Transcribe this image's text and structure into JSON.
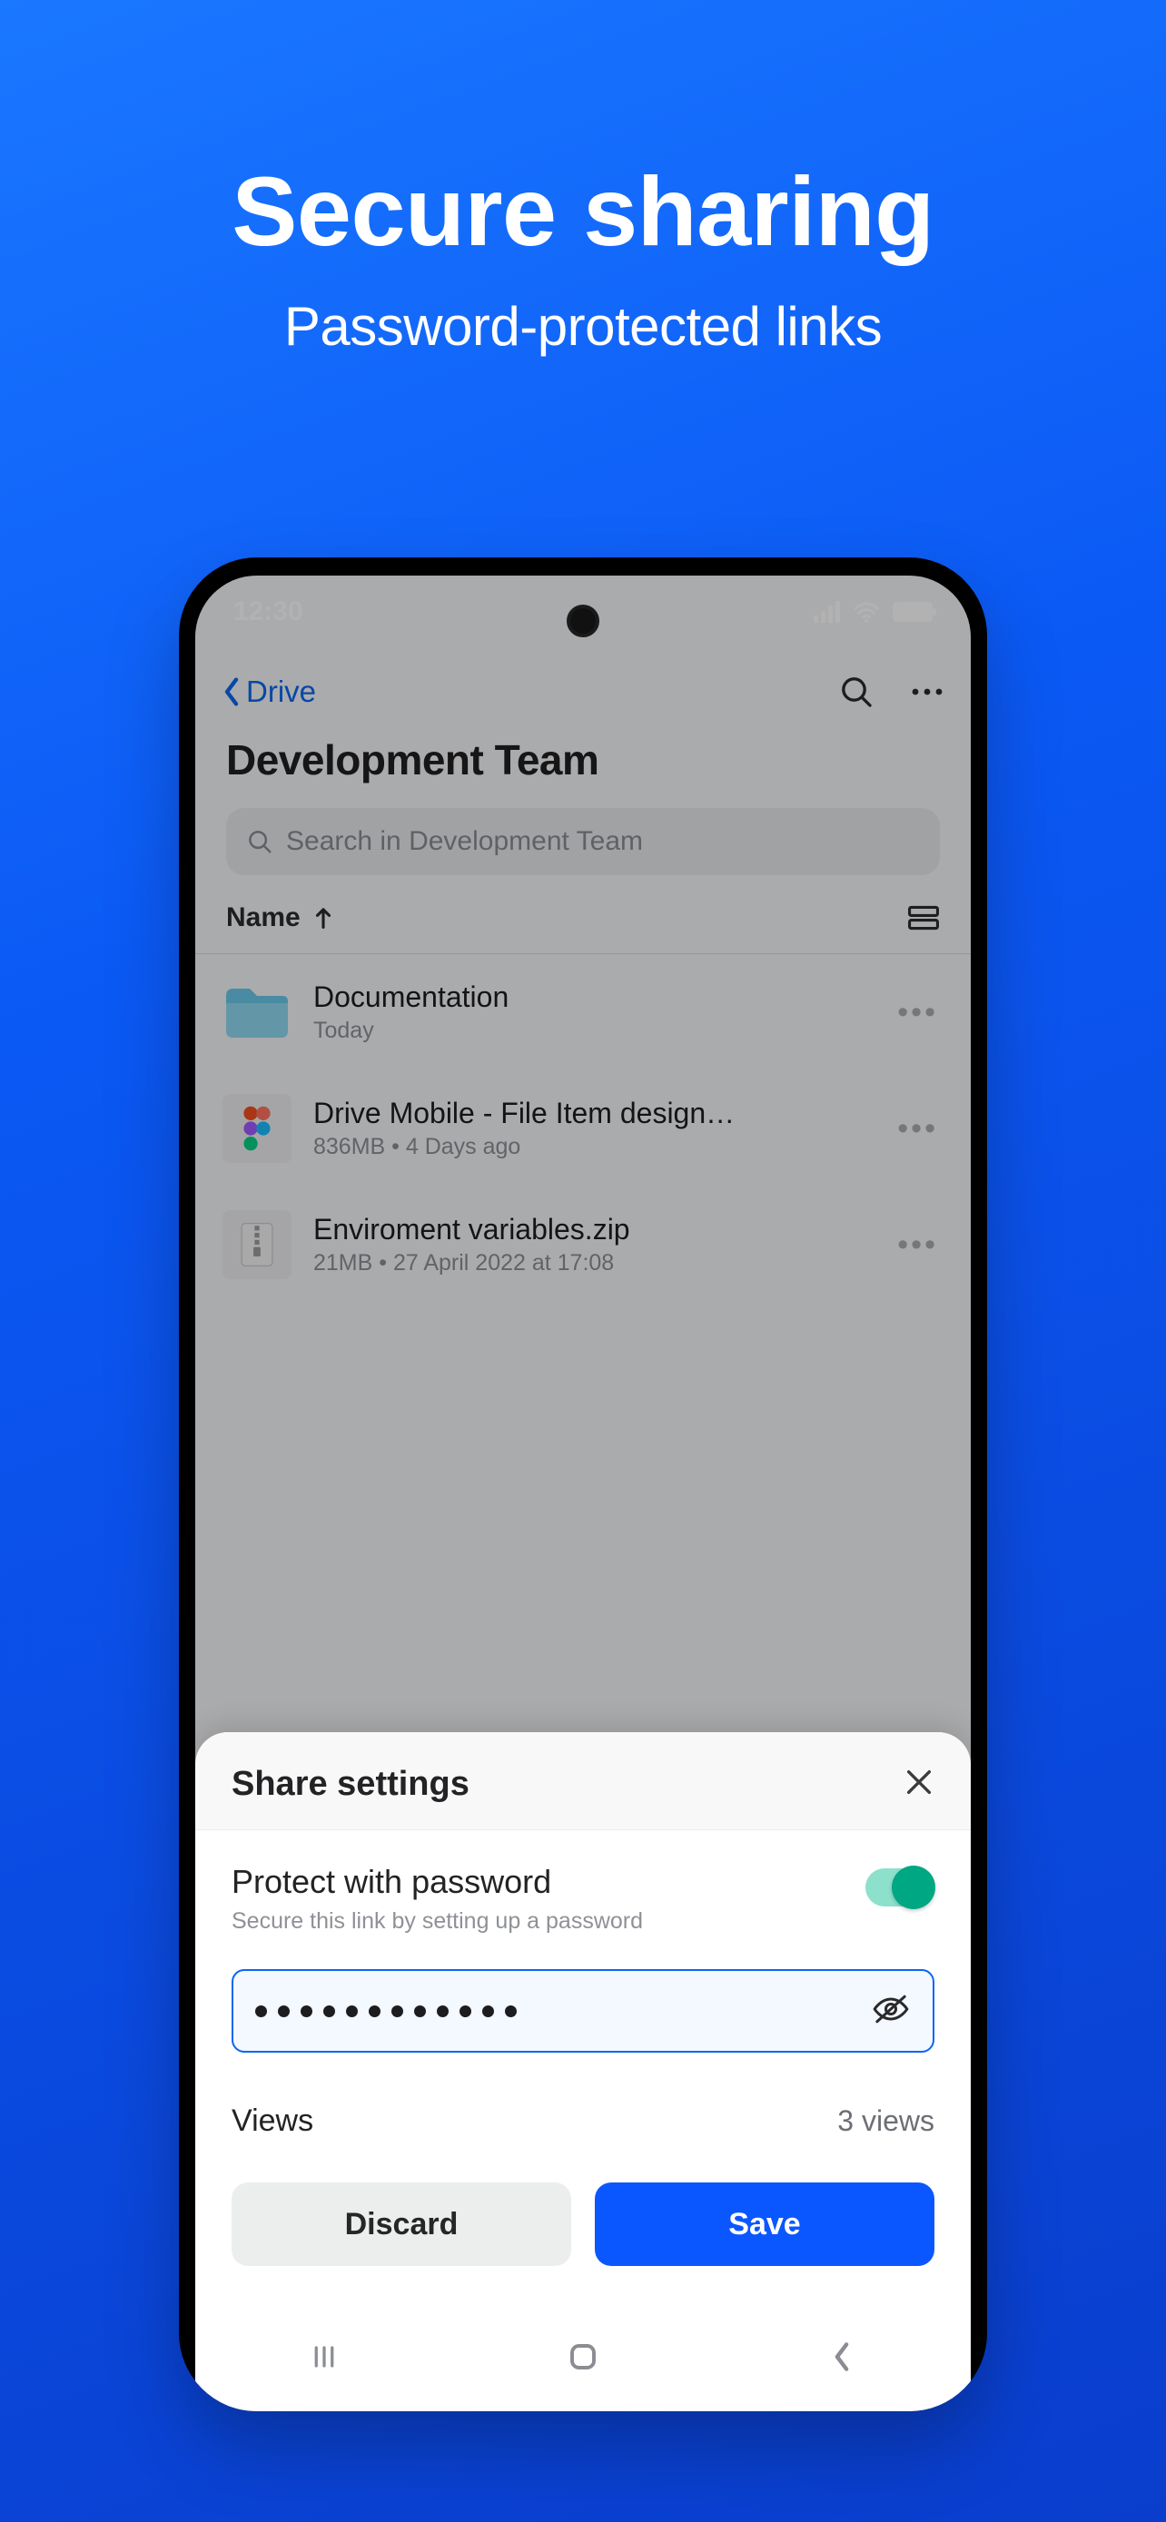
{
  "promo": {
    "title": "Secure sharing",
    "subtitle": "Password-protected links"
  },
  "statusbar": {
    "time": "12:30"
  },
  "appbar": {
    "back_label": "Drive"
  },
  "page": {
    "title": "Development Team",
    "search_placeholder": "Search in Development Team"
  },
  "sort": {
    "label": "Name"
  },
  "files": [
    {
      "name": "Documentation",
      "meta": "Today",
      "kind": "folder"
    },
    {
      "name": "Drive Mobile - File Item design…",
      "meta": "836MB  •  4 Days ago",
      "kind": "figma"
    },
    {
      "name": "Enviroment variables.zip",
      "meta": "21MB  •  27 April 2022 at 17:08",
      "kind": "zip"
    }
  ],
  "sheet": {
    "title": "Share settings",
    "protect_label": "Protect with password",
    "protect_sub": "Secure this link by setting up a password",
    "protect_on": true,
    "password_dots": 12,
    "views_label": "Views",
    "views_value": "3 views",
    "discard_label": "Discard",
    "save_label": "Save"
  }
}
